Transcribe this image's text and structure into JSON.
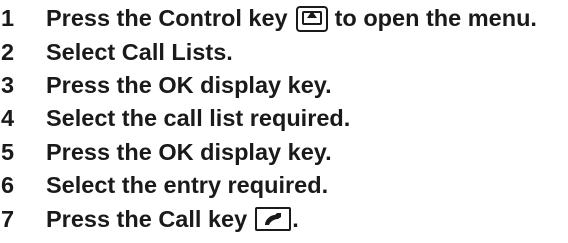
{
  "steps": [
    {
      "number": "1",
      "before": "Press the Control key",
      "after": "to open the menu.",
      "icon": "control-key-icon"
    },
    {
      "number": "2",
      "prefix": "Select ",
      "bold": "Call Lists",
      "suffix": "."
    },
    {
      "number": "3",
      "prefix": "Press the ",
      "bold": "OK",
      "suffix": " display key."
    },
    {
      "number": "4",
      "prefix": "Select the call list required.",
      "bold": "",
      "suffix": ""
    },
    {
      "number": "5",
      "prefix": "Press the ",
      "bold": "OK",
      "suffix": " display key."
    },
    {
      "number": "6",
      "prefix": "Select the entry required.",
      "bold": "",
      "suffix": ""
    },
    {
      "number": "7",
      "before": "Press the Call key",
      "after": ".",
      "icon": "call-key-icon"
    }
  ]
}
